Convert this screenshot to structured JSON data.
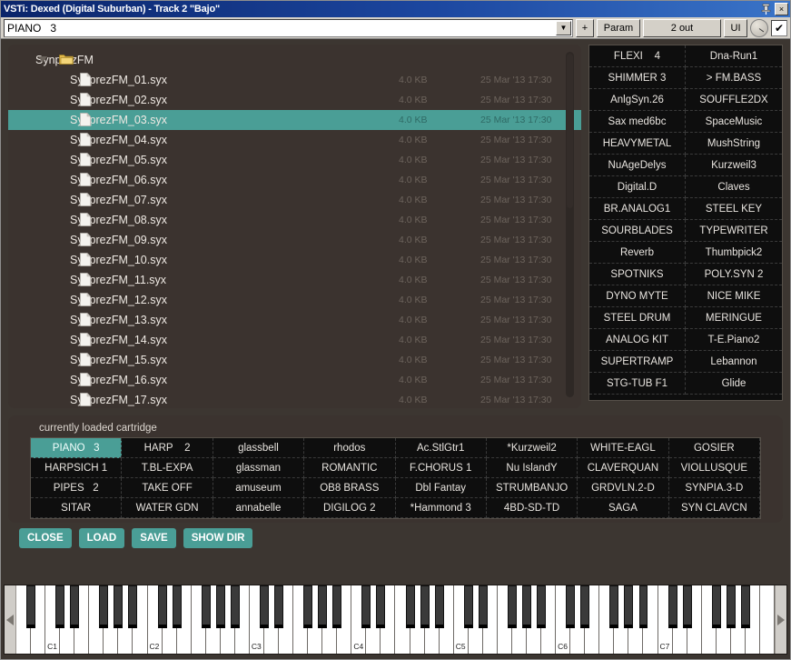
{
  "window": {
    "title": "VSTi: Dexed (Digital Suburban) - Track 2 \"Bajo\"",
    "pin_icon": "pin-icon",
    "close_label": "×"
  },
  "toolbar": {
    "preset_value": "PIANO   3",
    "combo_arrow": "▼",
    "add_label": "+",
    "param_label": "Param",
    "out_label": "2 out",
    "ui_label": "UI",
    "knob_icon": "knob-icon",
    "enable_checkbox": "✔"
  },
  "file_browser": {
    "folder": {
      "name": "SynprezFM",
      "expanded": true,
      "triangle": "▼"
    },
    "columns": {
      "size": "4.0 KB",
      "date": "25 Mar '13 17:30"
    },
    "selected_index": 2,
    "files": [
      {
        "name": "SynprezFM_01.syx",
        "size": "4.0 KB",
        "date": "25 Mar '13 17:30"
      },
      {
        "name": "SynprezFM_02.syx",
        "size": "4.0 KB",
        "date": "25 Mar '13 17:30"
      },
      {
        "name": "SynprezFM_03.syx",
        "size": "4.0 KB",
        "date": "25 Mar '13 17:30"
      },
      {
        "name": "SynprezFM_04.syx",
        "size": "4.0 KB",
        "date": "25 Mar '13 17:30"
      },
      {
        "name": "SynprezFM_05.syx",
        "size": "4.0 KB",
        "date": "25 Mar '13 17:30"
      },
      {
        "name": "SynprezFM_06.syx",
        "size": "4.0 KB",
        "date": "25 Mar '13 17:30"
      },
      {
        "name": "SynprezFM_07.syx",
        "size": "4.0 KB",
        "date": "25 Mar '13 17:30"
      },
      {
        "name": "SynprezFM_08.syx",
        "size": "4.0 KB",
        "date": "25 Mar '13 17:30"
      },
      {
        "name": "SynprezFM_09.syx",
        "size": "4.0 KB",
        "date": "25 Mar '13 17:30"
      },
      {
        "name": "SynprezFM_10.syx",
        "size": "4.0 KB",
        "date": "25 Mar '13 17:30"
      },
      {
        "name": "SynprezFM_11.syx",
        "size": "4.0 KB",
        "date": "25 Mar '13 17:30"
      },
      {
        "name": "SynprezFM_12.syx",
        "size": "4.0 KB",
        "date": "25 Mar '13 17:30"
      },
      {
        "name": "SynprezFM_13.syx",
        "size": "4.0 KB",
        "date": "25 Mar '13 17:30"
      },
      {
        "name": "SynprezFM_14.syx",
        "size": "4.0 KB",
        "date": "25 Mar '13 17:30"
      },
      {
        "name": "SynprezFM_15.syx",
        "size": "4.0 KB",
        "date": "25 Mar '13 17:30"
      },
      {
        "name": "SynprezFM_16.syx",
        "size": "4.0 KB",
        "date": "25 Mar '13 17:30"
      },
      {
        "name": "SynprezFM_17.syx",
        "size": "4.0 KB",
        "date": "25 Mar '13 17:30"
      }
    ]
  },
  "preset_list": [
    "FLEXI    4",
    "Dna-Run1",
    "SHIMMER 3",
    "> FM.BASS",
    "AnlgSyn.26",
    "SOUFFLE2DX",
    "Sax med6bc",
    "SpaceMusic",
    "HEAVYMETAL",
    "MushString",
    "NuAgeDelys",
    "Kurzweil3",
    "Digital.D",
    "Claves",
    "BR.ANALOG1",
    "STEEL KEY",
    "SOURBLADES",
    "TYPEWRITER",
    "Reverb",
    "Thumbpick2",
    "SPOTNIKS",
    "POLY.SYN 2",
    "DYNO MYTE",
    "NICE MIKE",
    "STEEL DRUM",
    "MERINGUE",
    "ANALOG KIT",
    "T-E.Piano2",
    "SUPERTRAMP",
    "Lebannon",
    "STG-TUB F1",
    "Glide"
  ],
  "cartridge": {
    "title": "currently loaded cartridge",
    "selected_index": 0,
    "slots": [
      "PIANO   3",
      "HARP    2",
      "glassbell",
      "rhodos",
      "Ac.StlGtr1",
      "*Kurzweil2",
      "WHITE-EAGL",
      "GOSIER",
      "HARPSICH 1",
      "T.BL-EXPA",
      "glassman",
      "ROMANTIC",
      "F.CHORUS 1",
      "Nu IslandY",
      "CLAVERQUAN",
      "VIOLLUSQUE",
      "PIPES   2",
      "TAKE OFF",
      "amuseum",
      "OB8 BRASS",
      "Dbl Fantay",
      "STRUMBANJO",
      "GRDVLN.2-D",
      "SYNPIA.3-D",
      "SITAR",
      "WATER GDN",
      "annabelle",
      "DIGILOG 2",
      "*Hammond 3",
      "4BD-SD-TD",
      "SAGA",
      "SYN CLAVCN"
    ]
  },
  "actions": [
    {
      "label": "CLOSE",
      "name": "close-button"
    },
    {
      "label": "LOAD",
      "name": "load-button"
    },
    {
      "label": "SAVE",
      "name": "save-button"
    },
    {
      "label": "SHOW DIR",
      "name": "show-dir-button"
    }
  ],
  "keyboard": {
    "octave_labels": [
      "C1",
      "C2",
      "C3",
      "C4",
      "C5",
      "C6",
      "C7"
    ],
    "scroll_left": "◀",
    "scroll_right": "▶",
    "white_key_count": 52
  },
  "colors": {
    "accent_teal": "#4a9e96",
    "panel_brown": "#3b332f",
    "body_brown": "#3c3631",
    "list_black": "#0e0e0e",
    "title_blue": "#0a246a"
  }
}
